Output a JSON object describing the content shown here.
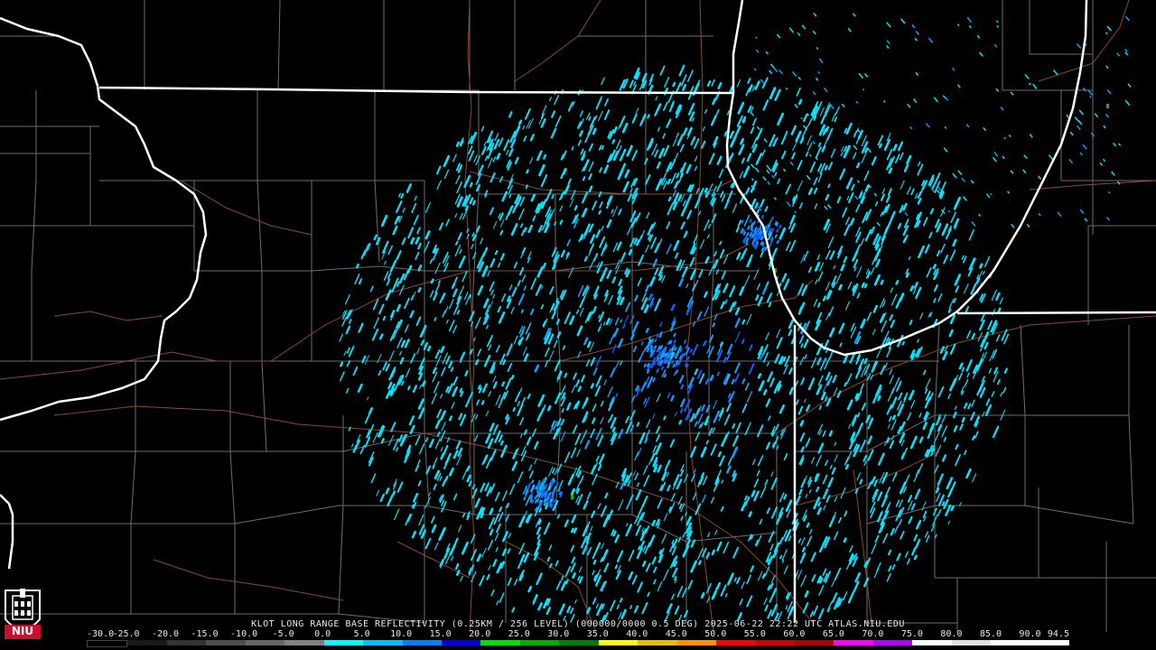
{
  "caption": "KLOT LONG RANGE BASE REFLECTIVITY (0.25KM / 256 LEVEL) (000000/0000 0.5 DEG) 2025-06-22 22:22 UTC  ATLAS.NIU.EDU",
  "logo": {
    "text": "NIU",
    "icon": "niu-castle-logo-icon",
    "color": "#c8102e"
  },
  "legend": {
    "labels": [
      "-30.0",
      "-25.0",
      "-20.0",
      "-15.0",
      "-10.0",
      "-5.0",
      "0.0",
      "5.0",
      "10.0",
      "15.0",
      "20.0",
      "25.0",
      "30.0",
      "35.0",
      "40.0",
      "45.0",
      "50.0",
      "55.0",
      "60.0",
      "65.0",
      "70.0",
      "75.0",
      "80.0",
      "85.0",
      "90.0",
      "94.5"
    ],
    "colors": [
      "#000000",
      "#1a1a1a",
      "#333333",
      "#4d4d4d",
      "#666666",
      "#808080",
      "#00ffff",
      "#00c0ff",
      "#0080ff",
      "#0000e0",
      "#00e000",
      "#00b000",
      "#008000",
      "#ffff00",
      "#e0c000",
      "#ff9000",
      "#ff0000",
      "#d00000",
      "#b00000",
      "#ff00ff",
      "#b000ff",
      "#ffffff",
      "#e0e0e0",
      "#ffffff",
      "#ffffff"
    ]
  },
  "map": {
    "state_border_color": "#ffffff",
    "county_line_color": "#6e6e6e",
    "road_color": "#8b4a2c",
    "echo_colors": [
      "#00e5ff",
      "#1ec8e8",
      "#0aa0ff",
      "#1060ff",
      "#0040d0",
      "#00c000"
    ]
  }
}
